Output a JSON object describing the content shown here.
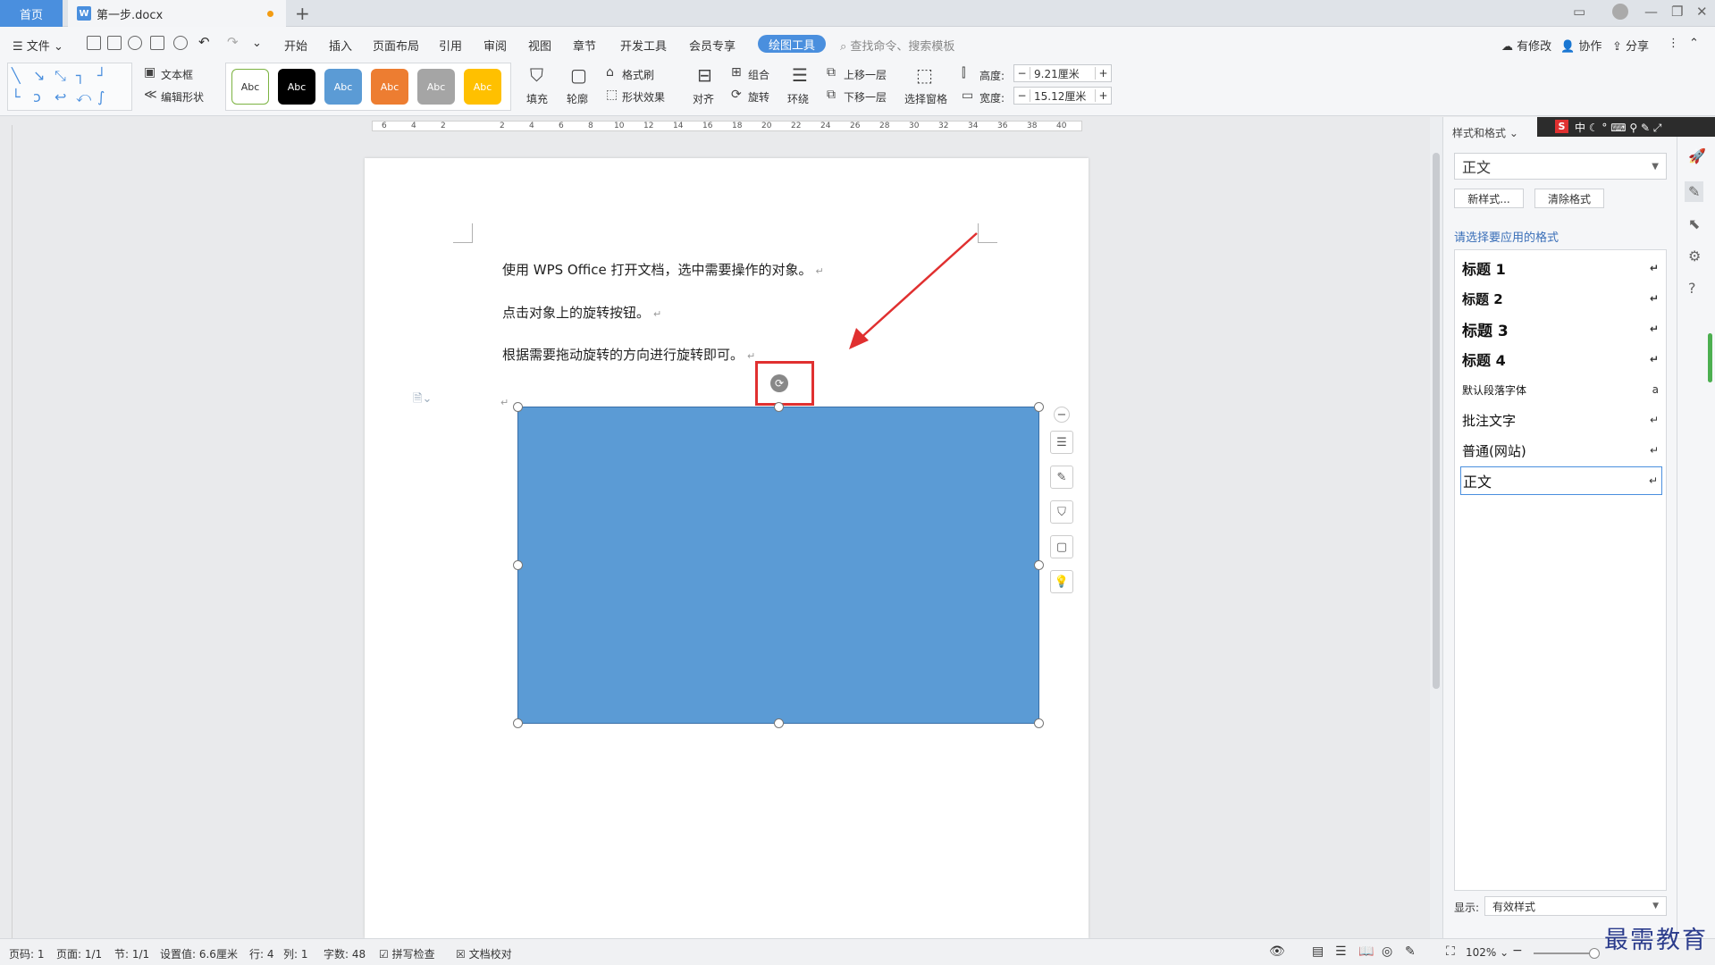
{
  "titlebar": {
    "home_tab": "首页",
    "doc_tab": "第一步.docx",
    "doc_icon": "W"
  },
  "menubar": {
    "file": "文件",
    "items": [
      "开始",
      "插入",
      "页面布局",
      "引用",
      "审阅",
      "视图",
      "章节",
      "开发工具",
      "会员专享"
    ],
    "active": "绘图工具",
    "search": "查找命令、搜索模板",
    "right": [
      "有修改",
      "协作",
      "分享"
    ]
  },
  "ribbon": {
    "textbox": "文本框",
    "editshape": "编辑形状",
    "style_buttons": [
      "Abc",
      "Abc",
      "Abc",
      "Abc",
      "Abc",
      "Abc"
    ],
    "fill": "填充",
    "outline": "轮廓",
    "format_painter": "格式刷",
    "shape_effect": "形状效果",
    "align": "对齐",
    "group": "组合",
    "rotate": "旋转",
    "wrap": "环绕",
    "bring_forward": "上移一层",
    "send_backward": "下移一层",
    "selection_pane": "选择窗格",
    "height_label": "高度:",
    "height_value": "9.21厘米",
    "width_label": "宽度:",
    "width_value": "15.12厘米"
  },
  "ruler": {
    "ticks": [
      "6",
      "4",
      "2",
      "2",
      "4",
      "6",
      "8",
      "10",
      "12",
      "14",
      "16",
      "18",
      "20",
      "22",
      "24",
      "26",
      "28",
      "30",
      "32",
      "34",
      "36",
      "38",
      "40"
    ]
  },
  "document": {
    "lines": [
      "使用 WPS Office 打开文档，选中需要操作的对象。",
      "点击对象上的旋转按钮。",
      "根据需要拖动旋转的方向进行旋转即可。"
    ],
    "pilcrow": "↵"
  },
  "pane": {
    "title": "样式和格式",
    "current_style": "正文",
    "new_style": "新样式...",
    "clear_format": "清除格式",
    "choose_label": "请选择要应用的格式",
    "styles": [
      {
        "name": "标题  1",
        "mark": "↵"
      },
      {
        "name": "标题  2",
        "mark": "↵"
      },
      {
        "name": "标题  3",
        "mark": "↵"
      },
      {
        "name": "标题  4",
        "mark": "↵"
      },
      {
        "name": "默认段落字体",
        "mark": "a"
      },
      {
        "name": "批注文字",
        "mark": "↵"
      },
      {
        "name": "普通(网站)",
        "mark": "↵"
      },
      {
        "name": "正文",
        "mark": "↵"
      }
    ],
    "show_label": "显示:",
    "show_value": "有效样式"
  },
  "statusbar": {
    "page_code": "页码: 1",
    "page": "页面: 1/1",
    "section": "节: 1/1",
    "setting": "设置值: 6.6厘米",
    "row": "行: 4",
    "col": "列: 1",
    "words": "字数: 48",
    "spell": "拼写检查",
    "proof": "文档校对",
    "zoom": "102%"
  },
  "watermark": "最需教育",
  "colors": {
    "accent": "#4a8fde",
    "shape_fill": "#5b9bd5",
    "highlight": "#e03030"
  }
}
